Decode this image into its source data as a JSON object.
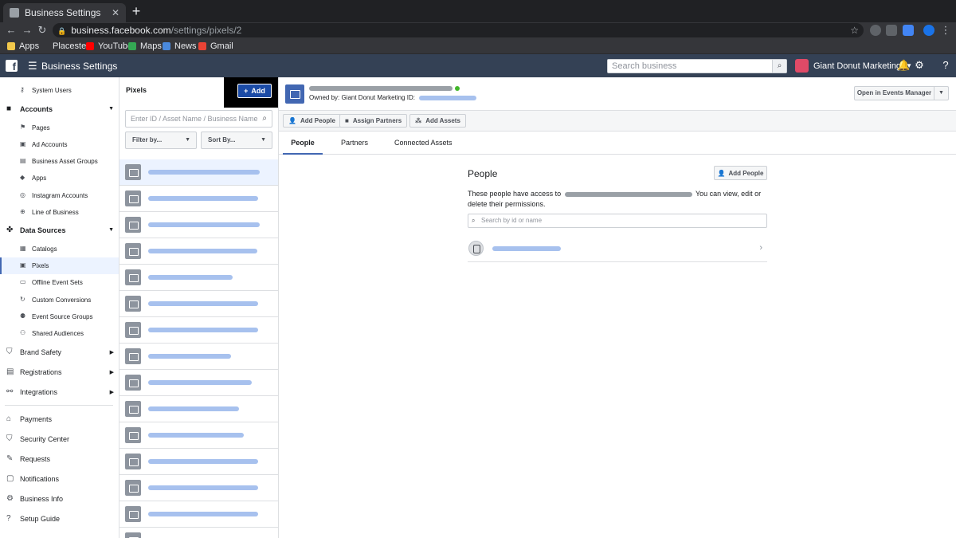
{
  "browser": {
    "tab_title": "Business Settings",
    "tab_close": "✕",
    "new_tab": "+",
    "url_host": "business.facebook.com",
    "url_path": "/settings/pixels/2",
    "bookmarks": [
      {
        "label": "Apps",
        "color": "#f2c84b"
      },
      {
        "label": "Placester",
        "color": "#35363a"
      },
      {
        "label": "YouTube",
        "color": "#ff0000"
      },
      {
        "label": "Maps",
        "color": "#34a853"
      },
      {
        "label": "News",
        "color": "#4a89dc"
      },
      {
        "label": "Gmail",
        "color": "#ea4335"
      }
    ]
  },
  "topbar": {
    "logo": "f",
    "title": "Business Settings",
    "search_placeholder": "Search business",
    "account_name": "Giant Donut Marketing"
  },
  "sidebar": {
    "items": [
      {
        "type": "item",
        "label": "System Users",
        "icon": "key-icon",
        "glyph": "⚷"
      },
      {
        "type": "header",
        "label": "Accounts",
        "icon": "briefcase-icon",
        "glyph": "■",
        "caret": "▼"
      },
      {
        "type": "item",
        "label": "Pages",
        "icon": "flag-icon",
        "glyph": "⚑"
      },
      {
        "type": "item",
        "label": "Ad Accounts",
        "icon": "ad-account-icon",
        "glyph": "▣"
      },
      {
        "type": "item",
        "label": "Business Asset Groups",
        "icon": "asset-groups-icon",
        "glyph": "▤"
      },
      {
        "type": "item",
        "label": "Apps",
        "icon": "apps-cube-icon",
        "glyph": "◆"
      },
      {
        "type": "item",
        "label": "Instagram Accounts",
        "icon": "instagram-icon",
        "glyph": "◎"
      },
      {
        "type": "item",
        "label": "Line of Business",
        "icon": "line-of-business-icon",
        "glyph": "⊕"
      },
      {
        "type": "header",
        "label": "Data Sources",
        "icon": "data-sources-icon",
        "glyph": "✤",
        "caret": "▼"
      },
      {
        "type": "item",
        "label": "Catalogs",
        "icon": "grid-icon",
        "glyph": "▦"
      },
      {
        "type": "item",
        "label": "Pixels",
        "icon": "pixel-icon",
        "glyph": "▣",
        "active": true
      },
      {
        "type": "item",
        "label": "Offline Event Sets",
        "icon": "store-icon",
        "glyph": "▭"
      },
      {
        "type": "item",
        "label": "Custom Conversions",
        "icon": "refresh-icon",
        "glyph": "↻"
      },
      {
        "type": "item",
        "label": "Event Source Groups",
        "icon": "people-icon",
        "glyph": "⚉"
      },
      {
        "type": "item",
        "label": "Shared Audiences",
        "icon": "audience-icon",
        "glyph": "⚇"
      },
      {
        "type": "big",
        "label": "Brand Safety",
        "icon": "shield-icon",
        "glyph": "⛉",
        "caret": "▶"
      },
      {
        "type": "big",
        "label": "Registrations",
        "icon": "clipboard-icon",
        "glyph": "▤",
        "caret": "▶"
      },
      {
        "type": "big",
        "label": "Integrations",
        "icon": "integrations-icon",
        "glyph": "⚯",
        "caret": "▶"
      },
      {
        "type": "divider"
      },
      {
        "type": "big",
        "label": "Payments",
        "icon": "bank-icon",
        "glyph": "⌂"
      },
      {
        "type": "big",
        "label": "Security Center",
        "icon": "security-shield-icon",
        "glyph": "⛉"
      },
      {
        "type": "big",
        "label": "Requests",
        "icon": "wrench-icon",
        "glyph": "✎"
      },
      {
        "type": "big",
        "label": "Notifications",
        "icon": "notification-icon",
        "glyph": "▢"
      },
      {
        "type": "big",
        "label": "Business Info",
        "icon": "gear-icon",
        "glyph": "⚙"
      },
      {
        "type": "big",
        "label": "Setup Guide",
        "icon": "help-icon",
        "glyph": "?"
      }
    ]
  },
  "pixels": {
    "title": "Pixels",
    "add_label": "Add",
    "search_placeholder": "Enter ID / Asset Name / Business Name",
    "filter_label": "Filter by...",
    "sort_label": "Sort By...",
    "rows": 15
  },
  "detail": {
    "owned_label": "Owned by: Giant Donut Marketing  ID:",
    "open_events_manager": "Open in Events Manager",
    "actions": [
      {
        "label": "Add People",
        "icon": "add-person-icon",
        "glyph": "👤"
      },
      {
        "label": "Assign Partners",
        "icon": "briefcase-icon",
        "glyph": "■"
      },
      {
        "label": "Add Assets",
        "icon": "assets-icon",
        "glyph": "⁂"
      }
    ],
    "tabs": [
      "People",
      "Partners",
      "Connected Assets"
    ],
    "people": {
      "title": "People",
      "add_button": "Add People",
      "desc_prefix": "These people have access to",
      "desc_suffix": "You can view, edit or delete their permissions.",
      "search_placeholder": "Search by id or name"
    }
  }
}
